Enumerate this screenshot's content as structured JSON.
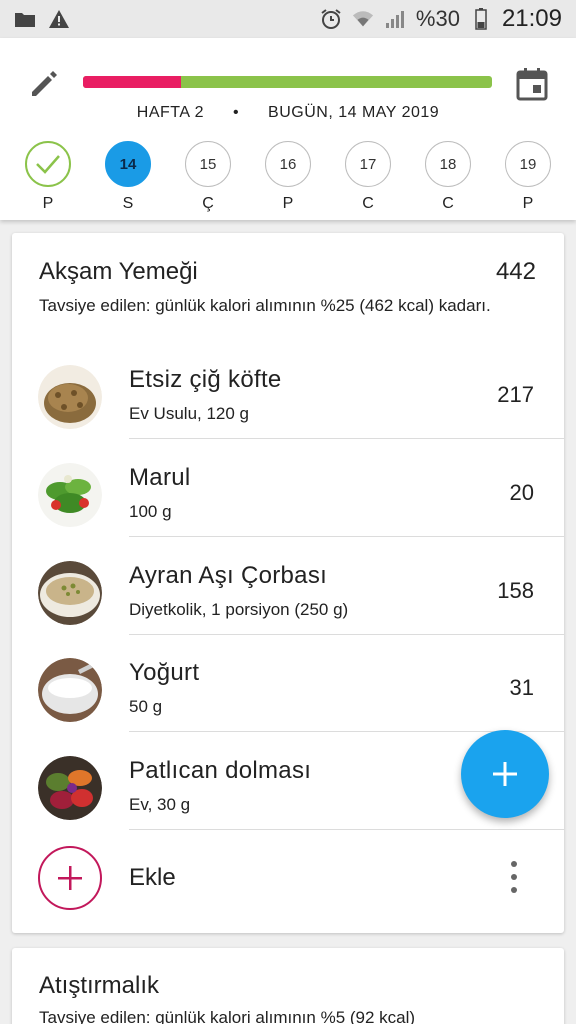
{
  "status_bar": {
    "battery_percent": "%30",
    "time": "21:09"
  },
  "header": {
    "progress_fraction": 0.24,
    "progress_colors": {
      "consumed": "#e91e63",
      "remaining": "#8bc34a"
    },
    "week_label": "HAFTA 2",
    "separator": "•",
    "today_label": "BUGÜN, 14 MAY 2019"
  },
  "days": [
    {
      "num": "",
      "label": "P",
      "state": "done"
    },
    {
      "num": "14",
      "label": "S",
      "state": "active"
    },
    {
      "num": "15",
      "label": "Ç",
      "state": "normal"
    },
    {
      "num": "16",
      "label": "P",
      "state": "normal"
    },
    {
      "num": "17",
      "label": "C",
      "state": "normal"
    },
    {
      "num": "18",
      "label": "C",
      "state": "normal"
    },
    {
      "num": "19",
      "label": "P",
      "state": "normal"
    }
  ],
  "meal": {
    "title": "Akşam Yemeği",
    "total": "442",
    "recommendation": "Tavsiye edilen: günlük kalori alımının %25 (462 kcal) kadarı.",
    "items": [
      {
        "name": "Etsiz çiğ köfte",
        "detail": "Ev Usulu, 120 g",
        "calories": "217"
      },
      {
        "name": "Marul",
        "detail": "100 g",
        "calories": "20"
      },
      {
        "name": "Ayran Aşı Çorbası",
        "detail": "Diyetkolik, 1 porsiyon (250 g)",
        "calories": "158"
      },
      {
        "name": "Yoğurt",
        "detail": "50 g",
        "calories": "31"
      },
      {
        "name": "Patlıcan dolması",
        "detail": "Ev, 30 g",
        "calories": ""
      }
    ],
    "add_label": "Ekle"
  },
  "snack": {
    "title": "Atıştırmalık",
    "recommendation": "Tavsiye edilen: günlük kalori alımının %5 (92 kcal)"
  },
  "colors": {
    "accent_blue": "#1aa3ee",
    "accent_pink": "#c2185b"
  }
}
